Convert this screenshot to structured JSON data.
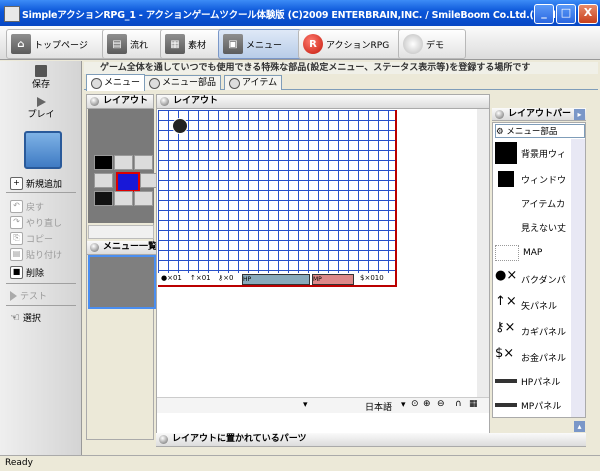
{
  "window": {
    "title": "SimpleアクションRPG_1 - アクションゲームツクール体験版 (C)2009 ENTERBRAIN,INC. / SmileBoom Co.Ltd.(Trial-1...",
    "minimize": "_",
    "maximize": "□",
    "close": "X"
  },
  "toolbar": {
    "items": [
      {
        "label": "トップページ"
      },
      {
        "label": "流れ"
      },
      {
        "label": "素材"
      },
      {
        "label": "メニュー"
      },
      {
        "label": "アクションRPG"
      },
      {
        "label": "デモ"
      }
    ]
  },
  "sidebar": {
    "save": "保存",
    "play": "プレイ",
    "add_new": "新規追加",
    "edit_items": [
      "戻す",
      "やり直し",
      "コピー",
      "貼り付け"
    ],
    "delete": "削除",
    "test": "テスト",
    "select": "選択"
  },
  "header": {
    "description": "ゲーム全体を通していつでも使用できる特殊な部品(設定メニュー、ステータス表示等)を登録する場所です"
  },
  "tabs": [
    "メニュー",
    "メニュー部品",
    "アイテム"
  ],
  "left_panel": {
    "title": "レイアウト",
    "menu_list_title": "メニュー一覧"
  },
  "main_panel": {
    "title": "レイアウト",
    "gauges": [
      "HP",
      "MP"
    ],
    "language": "日本語",
    "lower_title": "レイアウトに置かれているパーツ"
  },
  "right_panel": {
    "title": "レイアウトパー",
    "tab": "メニュー部品",
    "items": [
      {
        "label": "背景用ウィ",
        "swatch": "#000000"
      },
      {
        "label": "ウィンドウ",
        "swatch": "#000000"
      },
      {
        "label": "アイテムカ",
        "swatch": ""
      },
      {
        "label": "見えない丈",
        "swatch": ""
      },
      {
        "label": "MAP",
        "swatch": ""
      },
      {
        "label": "バクダンパ",
        "swatch": "icon"
      },
      {
        "label": "矢パネル",
        "swatch": "icon"
      },
      {
        "label": "カギパネル",
        "swatch": "icon"
      },
      {
        "label": "お金パネル",
        "swatch": "icon"
      },
      {
        "label": "HPパネル",
        "swatch": "bar"
      },
      {
        "label": "MPパネル",
        "swatch": "bar"
      }
    ]
  },
  "status": {
    "text": "Ready"
  }
}
